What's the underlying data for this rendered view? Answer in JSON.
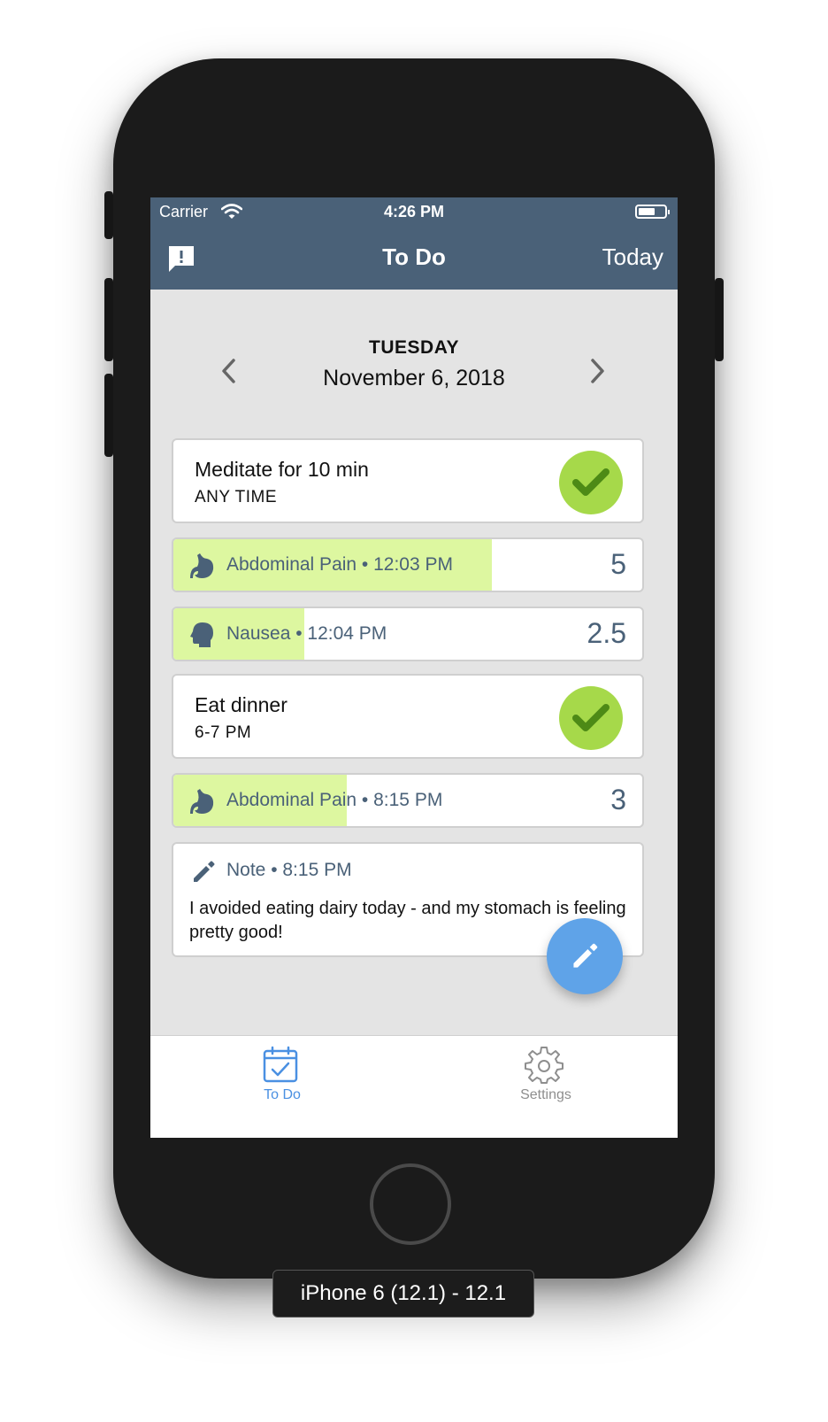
{
  "status_bar": {
    "carrier": "Carrier",
    "time": "4:26 PM"
  },
  "nav": {
    "title": "To Do",
    "today_label": "Today",
    "left_icon": "feedback-icon"
  },
  "date": {
    "weekday": "TUESDAY",
    "full": "November 6, 2018"
  },
  "items": [
    {
      "type": "task",
      "title": "Meditate for 10 min",
      "subtitle": "ANY TIME",
      "done": true
    },
    {
      "type": "symptom",
      "name": "Abdominal Pain",
      "time": "12:03 PM",
      "text": "Abdominal Pain • 12:03 PM",
      "value": "5",
      "fill_fraction": 0.68,
      "icon": "stomach-icon"
    },
    {
      "type": "symptom",
      "name": "Nausea",
      "time": "12:04 PM",
      "text": "Nausea • 12:04 PM",
      "value": "2.5",
      "fill_fraction": 0.28,
      "icon": "head-icon"
    },
    {
      "type": "task",
      "title": "Eat dinner",
      "subtitle": "6-7 PM",
      "done": true
    },
    {
      "type": "symptom",
      "name": "Abdominal Pain",
      "time": "8:15 PM",
      "text": "Abdominal Pain • 8:15 PM",
      "value": "3",
      "fill_fraction": 0.37,
      "icon": "stomach-icon"
    },
    {
      "type": "note",
      "header": "Note • 8:15 PM",
      "text": "I avoided eating dairy today - and my stomach is feeling pretty good!"
    }
  ],
  "tabs": [
    {
      "label": "To Do",
      "active": true,
      "icon": "calendar-check-icon"
    },
    {
      "label": "Settings",
      "active": false,
      "icon": "gear-icon"
    }
  ],
  "device_label": "iPhone 6 (12.1) - 12.1",
  "colors": {
    "nav": "#4a6178",
    "check": "#a6d94a",
    "symptom_fill": "#ddf7a0",
    "fab": "#5fa3e8",
    "tab_active": "#4a90e2"
  }
}
